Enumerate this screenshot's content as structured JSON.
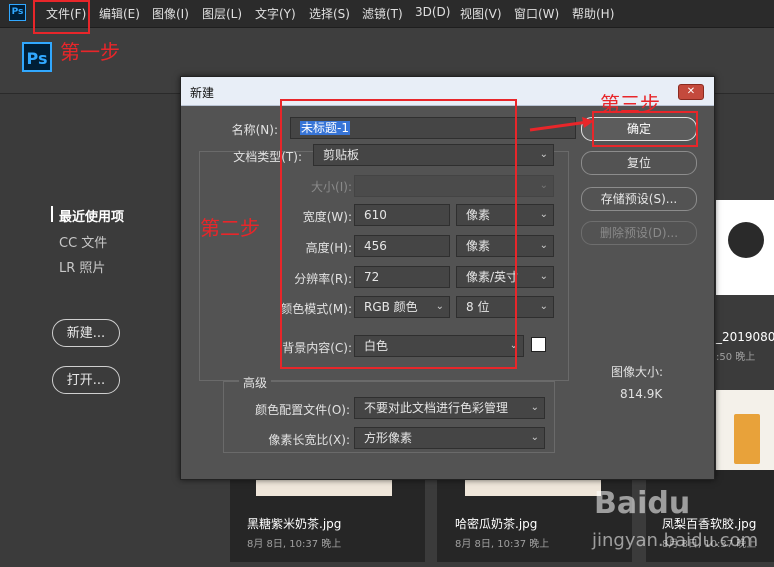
{
  "menubar": {
    "app_badge": "Ps",
    "items": [
      "文件(F)",
      "编辑(E)",
      "图像(I)",
      "图层(L)",
      "文字(Y)",
      "选择(S)",
      "滤镜(T)",
      "3D(D)",
      "视图(V)",
      "窗口(W)",
      "帮助(H)"
    ]
  },
  "topbar": {
    "logo": "Ps"
  },
  "annotations": {
    "step1": "第一步",
    "step2": "第二步",
    "step3": "第三步"
  },
  "left_nav": {
    "items": [
      "最近使用项",
      "CC 文件",
      "LR 照片"
    ],
    "new_button": "新建...",
    "open_button": "打开..."
  },
  "thumbnails": [
    {
      "title": "黑糖紫米奶茶.jpg",
      "date": "8月 8日, 10:37 晚上"
    },
    {
      "title": "哈密瓜奶茶.jpg",
      "date": "8月 8日, 10:37 晚上"
    },
    {
      "title": "凤梨百香软胶.jpg",
      "date": "8月 8日, 10:37 晚上"
    }
  ],
  "right_partial": {
    "line1": "_2019080",
    "line2": ":50 晚上"
  },
  "dialog": {
    "title": "新建",
    "close": "✕",
    "name_label": "名称(N):",
    "name_value": "未标题-1",
    "doc_type_label": "文档类型(T):",
    "doc_type_value": "剪贴板",
    "size_label": "大小(I):",
    "width_label": "宽度(W):",
    "width_value": "610",
    "width_unit": "像素",
    "height_label": "高度(H):",
    "height_value": "456",
    "height_unit": "像素",
    "resolution_label": "分辨率(R):",
    "resolution_value": "72",
    "resolution_unit": "像素/英寸",
    "color_mode_label": "颜色模式(M):",
    "color_mode_value": "RGB 颜色",
    "bit_depth": "8 位",
    "background_label": "背景内容(C):",
    "background_value": "白色",
    "advanced_label": "高级",
    "color_profile_label": "颜色配置文件(O):",
    "color_profile_value": "不要对此文档进行色彩管理",
    "pixel_aspect_label": "像素长宽比(X):",
    "pixel_aspect_value": "方形像素",
    "btn_ok": "确定",
    "btn_reset": "复位",
    "btn_save_preset": "存储预设(S)...",
    "btn_delete_preset": "删除预设(D)...",
    "image_size_label": "图像大小:",
    "image_size_value": "814.9K"
  },
  "watermark": {
    "brand": "Baidu",
    "sub": "jingyan.baidu.com"
  }
}
